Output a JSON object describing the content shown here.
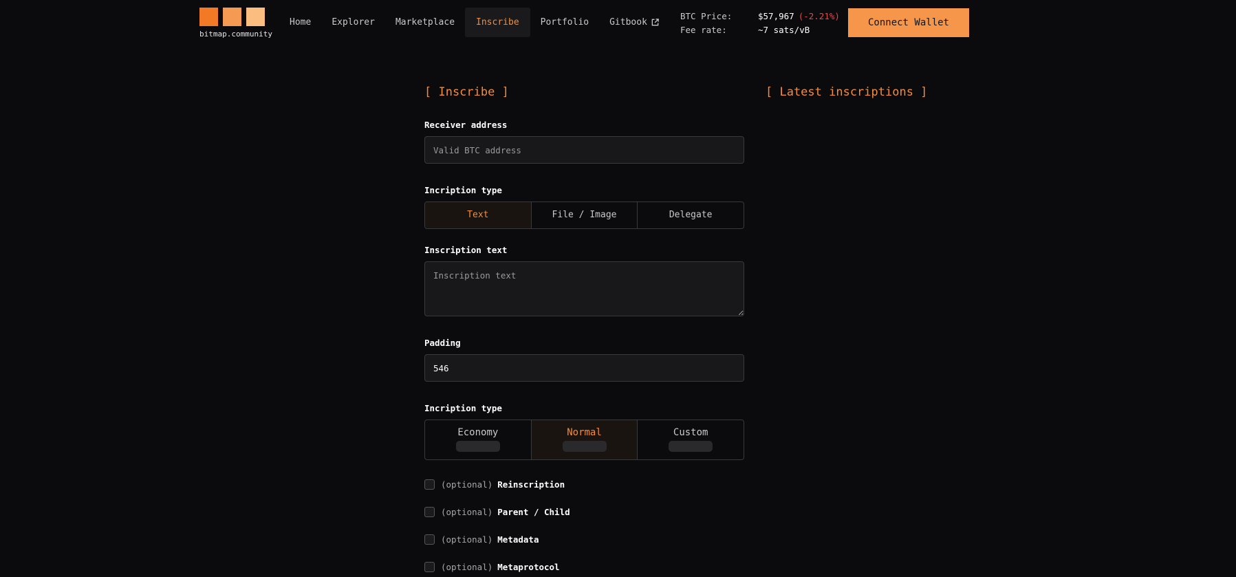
{
  "brand": {
    "name": "bitmap.community",
    "square_colors": [
      "#f27a26",
      "#f59a52",
      "#fbbd80"
    ]
  },
  "nav": {
    "items": [
      {
        "label": "Home"
      },
      {
        "label": "Explorer"
      },
      {
        "label": "Marketplace"
      },
      {
        "label": "Inscribe",
        "active": true
      },
      {
        "label": "Portfolio"
      },
      {
        "label": "Gitbook",
        "icon": "external-link-icon"
      }
    ]
  },
  "stats": {
    "btc_price_label": "BTC Price:",
    "btc_price_value": "$57,967",
    "btc_price_change": "(-2.21%)",
    "fee_rate_label": "Fee rate:",
    "fee_rate_value": "~7 sats/vB"
  },
  "connect_wallet_label": "Connect Wallet",
  "inscribe": {
    "title": "[ Inscribe ]",
    "receiver_label": "Receiver address",
    "receiver_placeholder": "Valid BTC address",
    "type_label": "Incription type",
    "type_options": [
      "Text",
      "File / Image",
      "Delegate"
    ],
    "type_selected": "Text",
    "text_label": "Inscription text",
    "text_placeholder": "Inscription text",
    "padding_label": "Padding",
    "padding_value": "546",
    "fee_label": "Incription type",
    "fee_options": [
      "Economy",
      "Normal",
      "Custom"
    ],
    "fee_selected": "Normal",
    "optional_prefix": "(optional)",
    "optional_items": [
      "Reinscription",
      "Parent / Child",
      "Metadata",
      "Metaprotocol"
    ]
  },
  "latest": {
    "title": "[ Latest inscriptions ]"
  },
  "colors": {
    "accent": "#f48c3c",
    "button_bg": "#f5964a",
    "negative": "#e84646",
    "background": "#0b0b0d"
  }
}
